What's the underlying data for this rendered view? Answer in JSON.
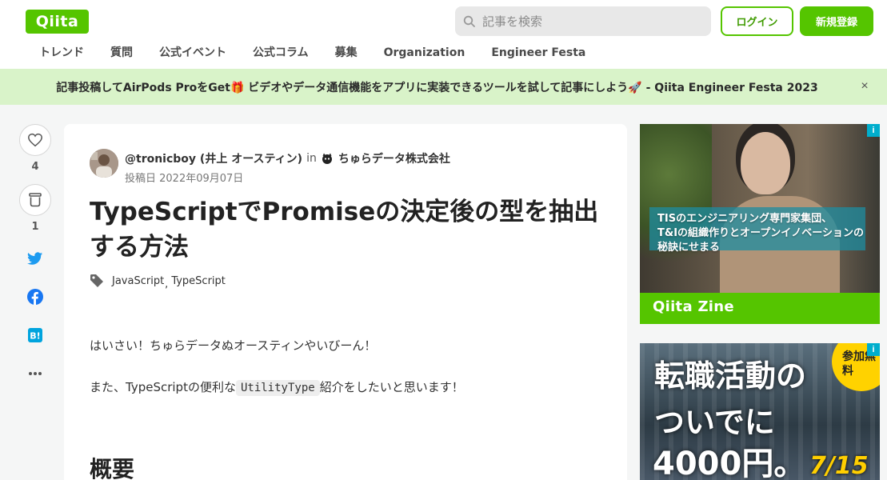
{
  "header": {
    "logo": "Qiita",
    "search_placeholder": "記事を検索",
    "login_label": "ログイン",
    "signup_label": "新規登録",
    "nav": [
      "トレンド",
      "質問",
      "公式イベント",
      "公式コラム",
      "募集",
      "Organization",
      "Engineer Festa"
    ]
  },
  "banner": {
    "text": "記事投稿してAirPods ProをGet🎁 ビデオやデータ通信機能をアプリに実装できるツールを試して記事にしよう🚀 - Qiita Engineer Festa 2023",
    "close": "×"
  },
  "rail": {
    "like_count": "4",
    "stock_count": "1"
  },
  "article": {
    "author": "@tronicboy (井上 オースティン)",
    "in_label": "in",
    "organization": "ちゅらデータ株式会社",
    "posted": "投稿日 2022年09月07日",
    "title": "TypeScriptでPromiseの決定後の型を抽出する方法",
    "tags": [
      "JavaScript",
      "TypeScript"
    ],
    "tag_sep": ",",
    "paragraph1": "はいさい！ちゅらデータぬオースティンやいびーん！",
    "paragraph2_before": "また、TypeScriptの便利な",
    "paragraph2_code": "UtilityType",
    "paragraph2_after": "紹介をしたいと思います！",
    "heading": "概要"
  },
  "ads": {
    "info_icon": "i",
    "ad1_line1": "TISのエンジニアリング専門家集団、",
    "ad1_line2": "T&Iの組織作りとオープンイノベーションの",
    "ad1_line3": "秘訣にせまる",
    "ad1_brand": "Qiita Zine",
    "ad2_line1": "転職活動の",
    "ad2_line2": "ついでに",
    "ad2_line3": "4000円。",
    "ad2_date": "7/15",
    "ad2_badge": "参加無料"
  },
  "colors": {
    "brand": "#55c500",
    "banner_bg": "#d9f3c9",
    "twitter": "#1d9bf0",
    "facebook": "#1877f2",
    "hatena": "#00a4de"
  }
}
